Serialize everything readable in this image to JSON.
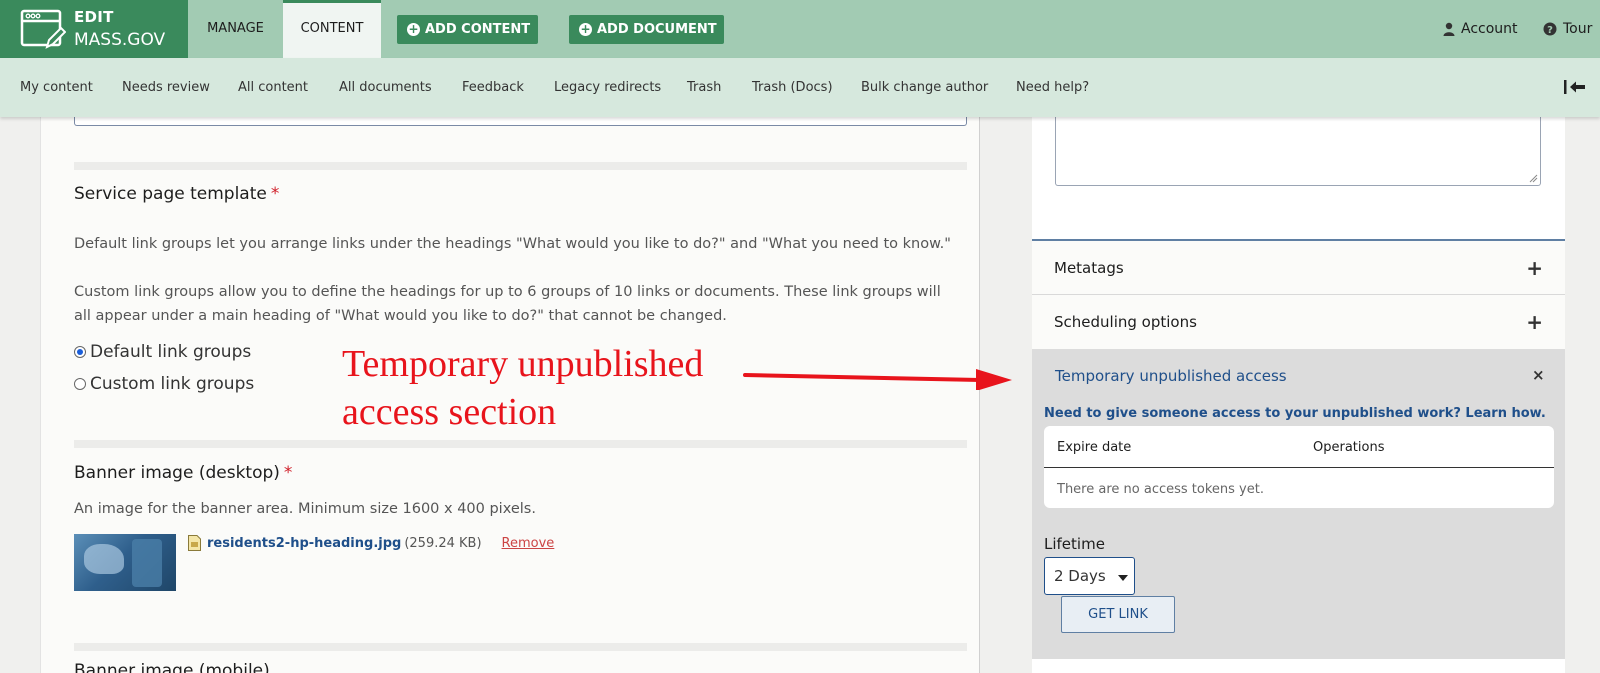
{
  "brand": {
    "line1": "EDIT",
    "line2": "MASS.GOV"
  },
  "toolbar": {
    "tabs": [
      {
        "label": "MANAGE"
      },
      {
        "label": "CONTENT"
      }
    ],
    "add_content": "ADD CONTENT",
    "add_document": "ADD DOCUMENT",
    "account": "Account",
    "tour": "Tour"
  },
  "subnav": {
    "items": [
      {
        "label": "My content"
      },
      {
        "label": "Needs review"
      },
      {
        "label": "All content"
      },
      {
        "label": "All documents"
      },
      {
        "label": "Feedback"
      },
      {
        "label": "Legacy redirects"
      },
      {
        "label": "Trash"
      },
      {
        "label": "Trash (Docs)"
      },
      {
        "label": "Bulk change author"
      },
      {
        "label": "Need help?"
      }
    ]
  },
  "form": {
    "template": {
      "title": "Service page template",
      "required_mark": "*",
      "desc1": "Default link groups let you arrange links under the headings \"What would you like to do?\" and \"What you need to know.\"",
      "desc2": "Custom link groups allow you to define the headings for up to 6 groups of 10 links or documents. These link groups will all appear under a main heading of \"What would you like to do?\" that cannot be changed.",
      "options": [
        {
          "label": "Default link groups",
          "selected": true
        },
        {
          "label": "Custom link groups",
          "selected": false
        }
      ]
    },
    "banner": {
      "title": "Banner image (desktop)",
      "required_mark": "*",
      "desc": "An image for the banner area. Minimum size 1600 x 400 pixels.",
      "file_name": "residents2-hp-heading.jpg",
      "file_size": "(259.24 KB)",
      "remove": "Remove"
    },
    "next_title": "Banner image (mobile)"
  },
  "annotation": {
    "line1": "Temporary unpublished",
    "line2": "access section"
  },
  "sidebar": {
    "metatags": "Metatags",
    "scheduling": "Scheduling options",
    "tua": {
      "title": "Temporary unpublished access",
      "help": "Need to give someone access to your unpublished work? Learn how.",
      "col_expire": "Expire date",
      "col_ops": "Operations",
      "empty": "There are no access tokens yet.",
      "lifetime_label": "Lifetime",
      "lifetime_value": "2 Days",
      "get_link": "GET LINK"
    }
  },
  "colors": {
    "brand_green": "#3a8a5c",
    "toolbar": "#a2cbb3",
    "subnav": "#d6e8dd",
    "link_blue": "#1f4f8a",
    "annotation_red": "#e8141c"
  }
}
